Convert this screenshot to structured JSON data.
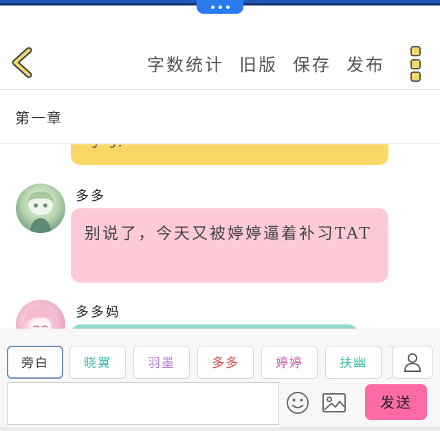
{
  "header": {
    "back_icon": "chevron-left-icon",
    "toolbar": [
      {
        "label": "字数统计"
      },
      {
        "label": "旧版"
      },
      {
        "label": "保存"
      },
      {
        "label": "发布"
      }
    ],
    "menu_icon": "more-vertical-icon"
  },
  "chapter": {
    "title": "第一章"
  },
  "chat": {
    "messages": [
      {
        "speaker": "",
        "text": "号 号.",
        "color": "#fbd766"
      },
      {
        "speaker": "多多",
        "text": "别说了，今天又被婷婷逼着补习TAT",
        "color": "#ffcad7"
      },
      {
        "speaker": "多多妈",
        "text": "",
        "color": "#8fd8cf"
      }
    ]
  },
  "roles": {
    "items": [
      {
        "label": "旁白",
        "color": "#3a3a3a",
        "selected": true
      },
      {
        "label": "晓翼",
        "color": "#3fb9b0"
      },
      {
        "label": "羽墨",
        "color": "#b57fd1"
      },
      {
        "label": "多多",
        "color": "#d94848"
      },
      {
        "label": "婷婷",
        "color": "#d05ab5"
      },
      {
        "label": "扶幽",
        "color": "#3fb9b0"
      }
    ],
    "user_icon": "user-icon"
  },
  "input": {
    "placeholder": "",
    "value": "",
    "emoji_icon": "smiley-icon",
    "image_icon": "image-icon",
    "send_label": "发送",
    "send_color": "#fd6aa5"
  }
}
